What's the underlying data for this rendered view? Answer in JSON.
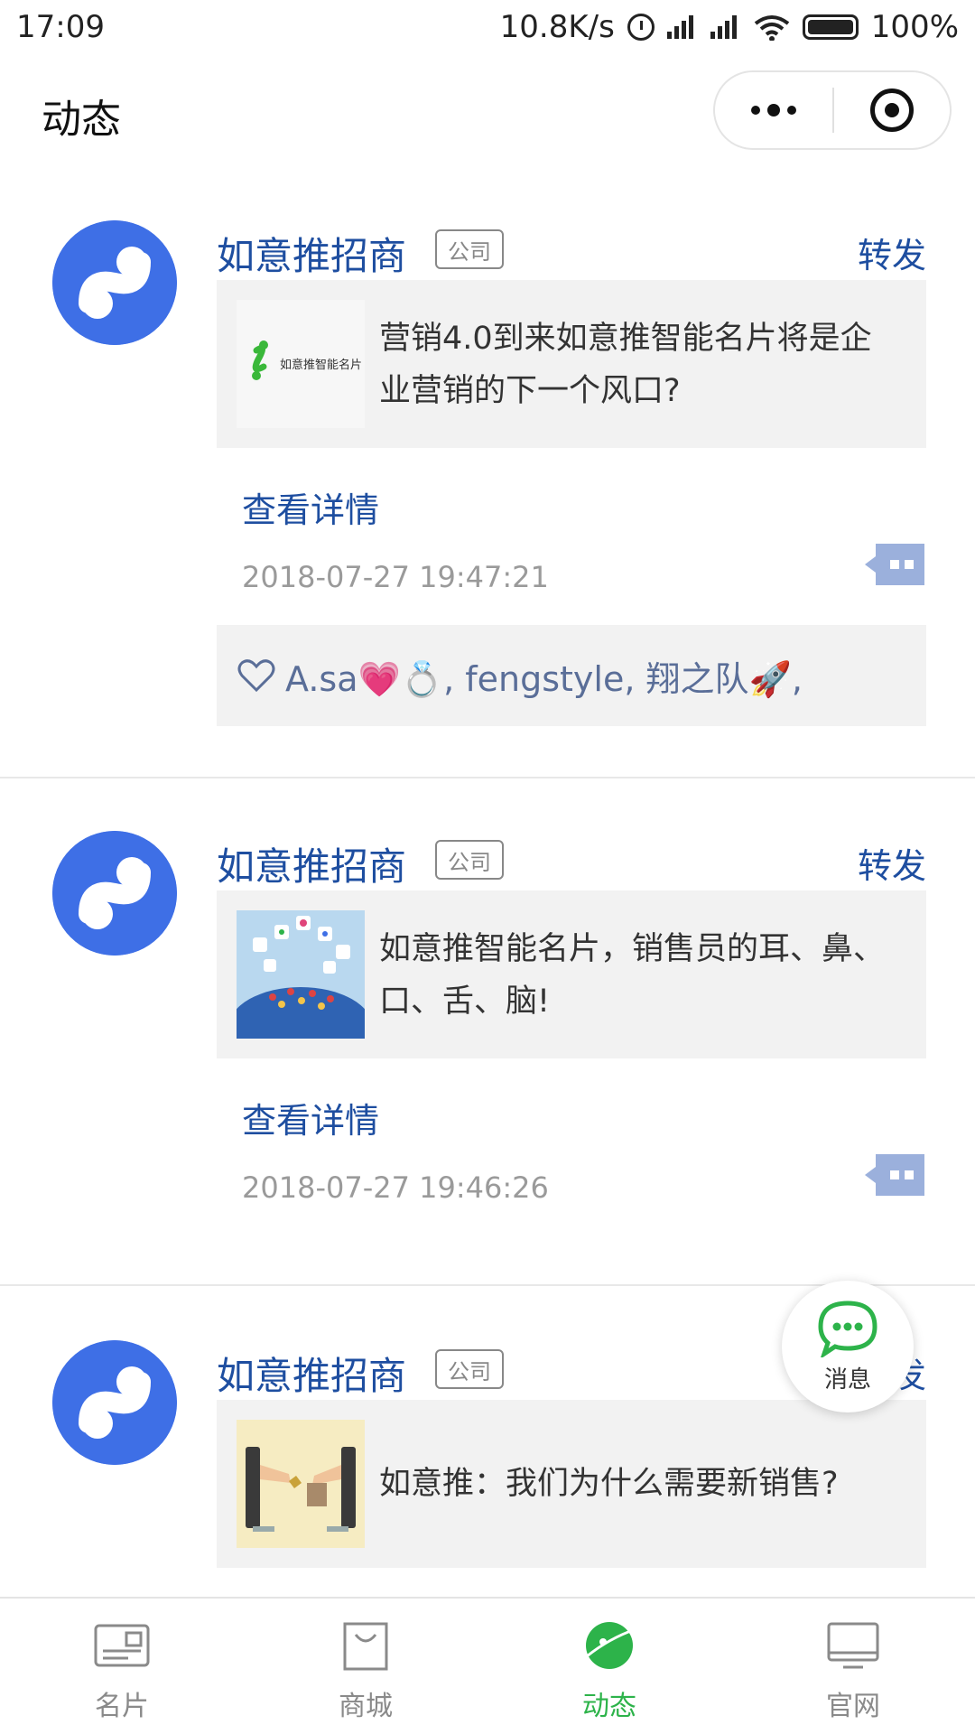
{
  "status_bar": {
    "time": "17:09",
    "speed": "10.8K/s",
    "battery": "100%"
  },
  "nav": {
    "title": "动态"
  },
  "posts": [
    {
      "author": "如意推招商",
      "tag": "公司",
      "forward": "转发",
      "title": "营销4.0到来如意推智能名片将是企业营销的下一个风口?",
      "thumb_text": "如意推智能名片",
      "details": "查看详情",
      "time": "2018-07-27 19:47:21",
      "likes": "A.sa💗💍, fengstyle, 翔之队🚀,"
    },
    {
      "author": "如意推招商",
      "tag": "公司",
      "forward": "转发",
      "title": "如意推智能名片，销售员的耳、鼻、口、舌、脑!",
      "details": "查看详情",
      "time": "2018-07-27 19:46:26"
    },
    {
      "author": "如意推招商",
      "tag": "公司",
      "forward": "转发",
      "title": "如意推：我们为什么需要新销售?"
    }
  ],
  "float_button": {
    "label": "消息"
  },
  "tabs": [
    {
      "label": "名片",
      "icon": "card-icon",
      "active": false
    },
    {
      "label": "商城",
      "icon": "bag-icon",
      "active": false
    },
    {
      "label": "动态",
      "icon": "planet-icon",
      "active": true
    },
    {
      "label": "官网",
      "icon": "monitor-icon",
      "active": false
    }
  ],
  "colors": {
    "link_blue": "#1e4ea0",
    "avatar_blue": "#3e6fe6",
    "active_green": "#2db34a",
    "card_bg": "#f2f2f2"
  }
}
